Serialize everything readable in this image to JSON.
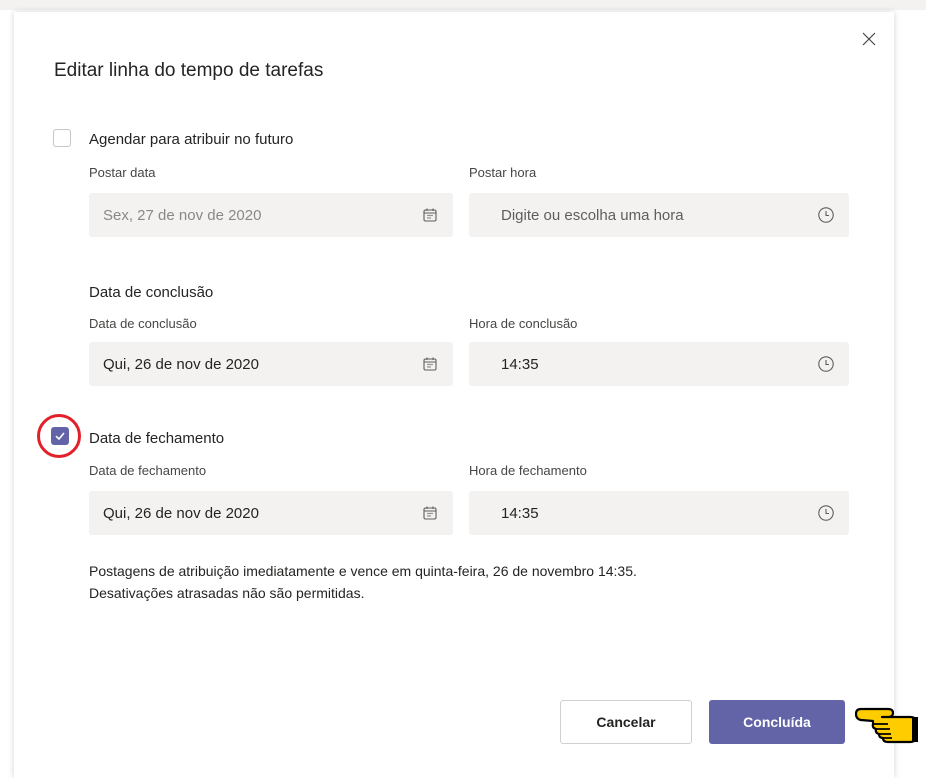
{
  "dialog": {
    "title": "Editar linha do tempo de tarefas",
    "schedule": {
      "checkbox_label": "Agendar para atribuir no futuro",
      "checked": false,
      "post_date": {
        "label": "Postar data",
        "value": "Sex, 27 de nov de 2020"
      },
      "post_time": {
        "label": "Postar hora",
        "placeholder": "Digite ou escolha uma hora"
      }
    },
    "due": {
      "section_label": "Data de conclusão",
      "date": {
        "label": "Data de conclusão",
        "value": "Qui, 26 de nov de 2020"
      },
      "time": {
        "label": "Hora de conclusão",
        "value": "14:35"
      }
    },
    "close": {
      "checkbox_label": "Data de fechamento",
      "checked": true,
      "date": {
        "label": "Data de fechamento",
        "value": "Qui, 26 de nov de 2020"
      },
      "time": {
        "label": "Hora de fechamento",
        "value": "14:35"
      }
    },
    "summary": {
      "line1": "Postagens de atribuição imediatamente e vence em quinta-feira, 26 de novembro 14:35.",
      "line2": "Desativações atrasadas não são permitidas."
    },
    "buttons": {
      "cancel": "Cancelar",
      "done": "Concluída"
    }
  },
  "icons": {
    "close": "close-icon",
    "calendar": "calendar-icon",
    "clock": "clock-icon",
    "check": "checkmark-icon",
    "pointer": "pointing-hand-icon"
  },
  "colors": {
    "accent": "#6264a7",
    "field_background": "#f3f2f1",
    "annotation": "#e3202a",
    "hand": "#ffcc00"
  }
}
